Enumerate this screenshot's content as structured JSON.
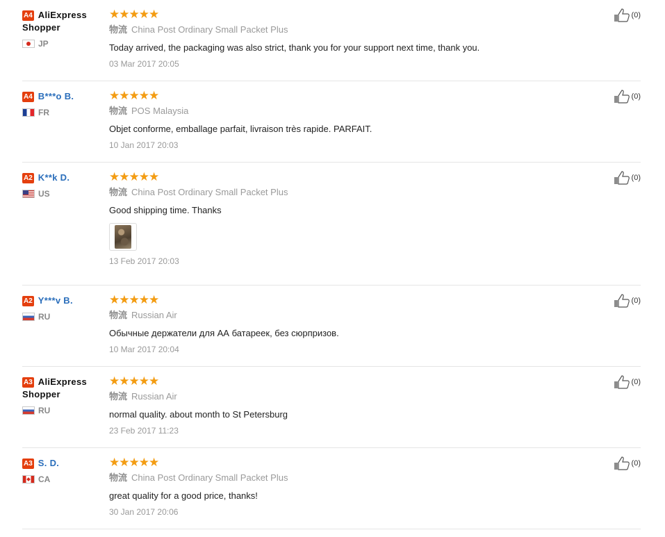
{
  "logistics_label": "物流",
  "accent": "#e43f0e",
  "star_color": "#f39c12",
  "reviews": [
    {
      "level": "A4",
      "name": "AliExpress Shopper",
      "flag": "jp",
      "country": "JP",
      "stars": "★★★★★",
      "rating": 5,
      "shipping": "China Post Ordinary Small Packet Plus",
      "text": "Today arrived, the packaging was also strict, thank you for your support next time, thank you.",
      "date": "03 Mar 2017 20:05",
      "likes": "(0)"
    },
    {
      "level": "A4",
      "name": "B***o B.",
      "flag": "fr",
      "country": "FR",
      "stars": "★★★★★",
      "rating": 5,
      "shipping": "POS Malaysia",
      "text": "Objet conforme, emballage parfait, livraison très rapide. PARFAIT.",
      "date": "10 Jan 2017 20:03",
      "likes": "(0)"
    },
    {
      "level": "A2",
      "name": "K**k D.",
      "flag": "us",
      "country": "US",
      "stars": "★★★★★",
      "rating": 5,
      "shipping": "China Post Ordinary Small Packet Plus",
      "text": "Good shipping time. Thanks",
      "date": "13 Feb 2017 20:03",
      "likes": "(0)",
      "has_photo": true
    },
    {
      "level": "A2",
      "name": "Y***v B.",
      "flag": "ru",
      "country": "RU",
      "stars": "★★★★★",
      "rating": 5,
      "shipping": "Russian Air",
      "text": "Обычные держатели для АА батареек, без сюрпризов.",
      "date": "10 Mar 2017 20:04",
      "likes": "(0)"
    },
    {
      "level": "A3",
      "name": "AliExpress Shopper",
      "flag": "ru",
      "country": "RU",
      "stars": "★★★★★",
      "rating": 5,
      "shipping": "Russian Air",
      "text": "normal quality. about month to St Petersburg",
      "date": "23 Feb 2017 11:23",
      "likes": "(0)"
    },
    {
      "level": "A3",
      "name": "S. D.",
      "flag": "ca",
      "country": "CA",
      "stars": "★★★★★",
      "rating": 5,
      "shipping": "China Post Ordinary Small Packet Plus",
      "text": "great quality for a good price, thanks!",
      "date": "30 Jan 2017 20:06",
      "likes": "(0)"
    }
  ]
}
